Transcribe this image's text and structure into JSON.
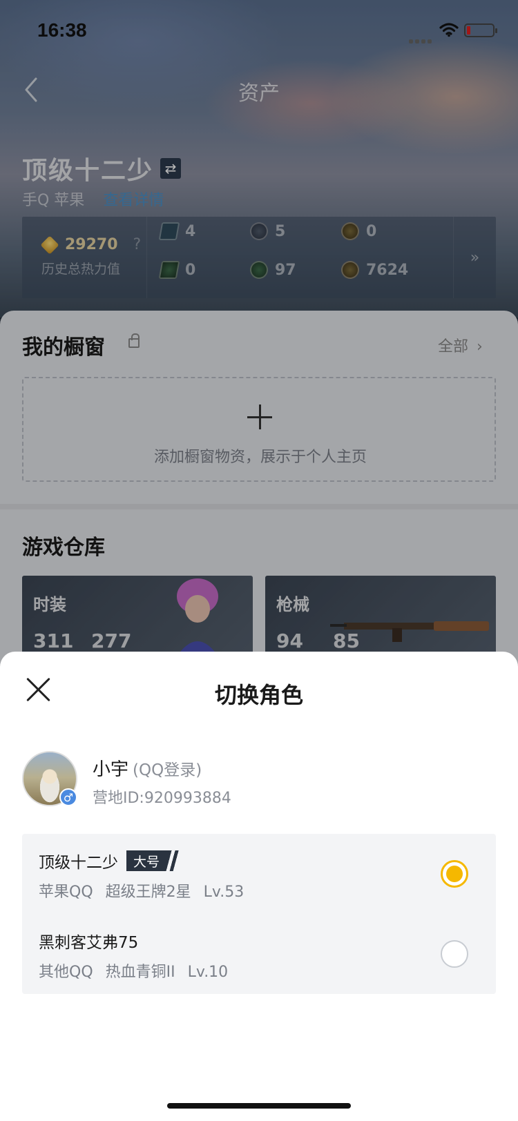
{
  "status_bar": {
    "time": "16:38"
  },
  "nav": {
    "title": "资产"
  },
  "character": {
    "name": "顶级十二少",
    "platform": "手Q 苹果",
    "link": "查看详情"
  },
  "stats": {
    "heat_value": "29270",
    "heat_help": "?",
    "heat_label": "历史总热力值",
    "items": [
      {
        "icon": "card-icon",
        "value": "4"
      },
      {
        "icon": "silver-coin-icon",
        "value": "5"
      },
      {
        "icon": "gold-medal-icon",
        "value": "0"
      },
      {
        "icon": "green-card-icon",
        "value": "0"
      },
      {
        "icon": "green-orb-icon",
        "value": "97"
      },
      {
        "icon": "bronze-coin-icon",
        "value": "7624"
      }
    ],
    "more": "»"
  },
  "showcase": {
    "title": "我的橱窗",
    "all": "全部",
    "all_arrow": "›",
    "add_hint": "添加橱窗物资，展示于个人主页"
  },
  "warehouse": {
    "title": "游戏仓库",
    "tiles": [
      {
        "label": "时装",
        "a": "311",
        "b": "277"
      },
      {
        "label": "枪械",
        "a": "94",
        "b": "85"
      }
    ]
  },
  "sheet": {
    "title": "切换角色",
    "profile": {
      "name": "小宇",
      "login": "(QQ登录)",
      "camp_id": "营地ID:920993884",
      "gender": "♂"
    },
    "roles": [
      {
        "name": "顶级十二少",
        "tag": "大号",
        "platform": "苹果QQ",
        "rank": "超级王牌2星",
        "level": "Lv.53",
        "selected": true
      },
      {
        "name": "黑刺客艾弗75",
        "tag": "",
        "platform": "其他QQ",
        "rank": "热血青铜II",
        "level": "Lv.10",
        "selected": false
      }
    ]
  },
  "colors": {
    "accent": "#f5b800",
    "link": "#4a90c8",
    "gender_badge": "#4a8ae0"
  }
}
